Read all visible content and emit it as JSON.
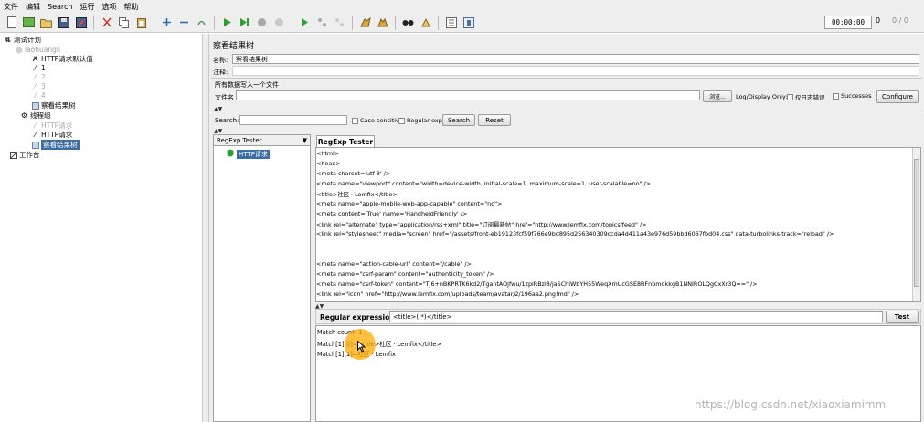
{
  "menu": [
    "文件",
    "编辑",
    "Search",
    "运行",
    "选项",
    "帮助"
  ],
  "toolbar_icons": [
    "new-icon",
    "templates-icon",
    "open-icon",
    "save-icon",
    "save-as-icon",
    "cut-icon",
    "copy-icon",
    "paste-icon",
    "expand-icon",
    "collapse-icon",
    "toggle-icon",
    "start-icon",
    "start-no-pause-icon",
    "stop-icon",
    "shutdown-icon",
    "remote-start-icon",
    "remote-stop-icon",
    "remote-shutdown-icon",
    "clear-icon",
    "clear-all-icon",
    "search-icon",
    "reset-search-icon",
    "function-helper-icon",
    "help-icon"
  ],
  "clock": "00:00:00",
  "toolbar_right": {
    "warnings": "0",
    "threads": "0 / 0"
  },
  "tree": {
    "root": "测试计划",
    "child_server": "laohuangli",
    "http_defaults": "HTTP请求默认值",
    "sampler_1": "1",
    "sampler_2": "2",
    "sampler_3": "3",
    "sampler_4": "4",
    "listener_1": "察看结果树",
    "thread_group": "线程组",
    "http_request_1": "HTTP请求",
    "http_request_2": "HTTP请求",
    "listener_selected": "察看结果树",
    "workbench": "工作台"
  },
  "panel": {
    "title": "察看结果树",
    "name_label": "名称:",
    "name_value": "察看结果树",
    "comment_label": "注释:",
    "write_all_label": "所有数据写入一个文件",
    "filename_label": "文件名",
    "browse_label": "浏览...",
    "log_display_label": "Log/Display Only:",
    "errors_only_label": "仅日志错误",
    "successes_label": "Successes",
    "configure_label": "Configure",
    "search_label": "Search:",
    "case_sensitive_label": "Case sensitive",
    "regular_exp_label": "Regular exp.",
    "search_button": "Search",
    "reset_button": "Reset"
  },
  "renderer": {
    "selected": "RegExp Tester"
  },
  "results_tree": {
    "item": "HTTP请求"
  },
  "tab_label": "RegExp Tester",
  "html_lines": [
    "<html>",
    "<head>",
    "  <meta charset='utf-8' />",
    "  <meta name=\"viewport\" content=\"width=device-width, initial-scale=1, maximum-scale=1, user-scalable=no\" />",
    "  <title>社区 · Lemfix</title>",
    "  <meta name=\"apple-mobile-web-app-capable\" content=\"no\">",
    "  <meta content='True' name='HandheldFriendly' />",
    "  <link rel=\"alternate\" type=\"application/rss+xml\" title=\"订阅最新帖\" href=\"http://www.lemfix.com/topics/feed\" />",
    "  <link rel=\"stylesheet\" media=\"screen\" href=\"/assets/front-eb19123fcf59f766e9bd895d256340309ccda4d411a43e976d59bbd6067fbd04.css\" data-turbolinks-track=\"reload\" />",
    "",
    "",
    "  <meta name=\"action-cable-url\" content=\"/cable\" />",
    "  <meta name=\"csrf-param\" content=\"authenticity_token\" />",
    "<meta name=\"csrf-token\" content=\"TJ6+nBKPRTK6kd2/TgantAOjfwu/1zplRBzl8/jaSChiWbYH55WeqXmUcGSE8RFnbmqkkgB1NNIROLQgCxXr3Q==\" />",
    "  <link rel=\"icon\" href=\"http://www.lemfix.com/uploads/team/avatar/2/196aa2.png!md\" />"
  ],
  "regex": {
    "label": "Regular expression:",
    "value": "<title>(.*)</title>",
    "test_button": "Test"
  },
  "results": [
    "Match count: 1",
    "Match[1][0]=<title>社区 · Lemfix</title>",
    "Match[1][1]=社区 · Lemfix"
  ],
  "watermark": "https://blog.csdn.net/xiaoxiamimm"
}
